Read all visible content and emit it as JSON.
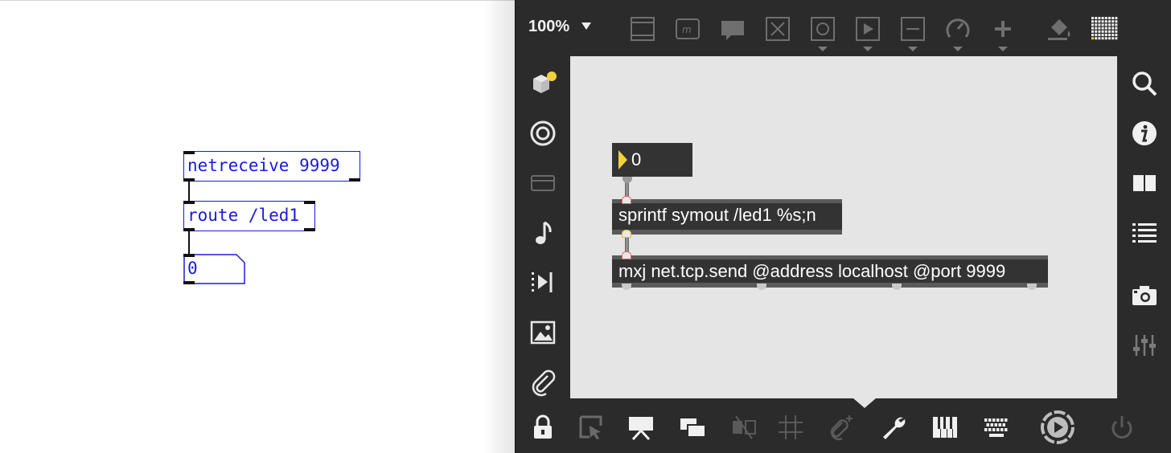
{
  "pd_patch": {
    "netreceive_text": "netreceive 9999",
    "route_text": "route /led1",
    "number_value": "0"
  },
  "max_window": {
    "zoom": "100%",
    "toolbar_icons": [
      "presentation-icon",
      "message-box-icon",
      "comment-icon",
      "toggle-icon",
      "button-icon",
      "play-icon",
      "slider-icon",
      "dial-icon",
      "add-object-icon",
      "paint-bucket-icon",
      "grid-palette-icon"
    ],
    "left_sidebar_icons": [
      "packages-icon",
      "target-icon",
      "media-icon",
      "music-note-icon",
      "sequencer-icon",
      "image-icon",
      "paperclip-icon"
    ],
    "right_sidebar_icons": [
      "search-icon",
      "info-icon",
      "book-icon",
      "list-icon",
      "camera-icon",
      "mixer-icon"
    ],
    "bottom_icons": [
      "lock-icon",
      "edit-select-icon",
      "presentation-mode-icon",
      "windows-icon",
      "hide-icon",
      "grid-icon",
      "attach-icon",
      "wrench-icon",
      "piano-icon",
      "keyboard-icon",
      "play-circle-icon",
      "power-icon"
    ],
    "number_value": "0",
    "sprintf_text": "sprintf symout /led1 %s;n",
    "mxj_text": "mxj net.tcp.send @address localhost @port 9999"
  },
  "colors": {
    "pd_blue": "#1a1ae0",
    "max_bg": "#2b2b2b",
    "canvas_bg": "#e5e5e5",
    "max_object": "#333333",
    "accent_yellow": "#f4d03f",
    "inlet_red": "#e0606a"
  }
}
